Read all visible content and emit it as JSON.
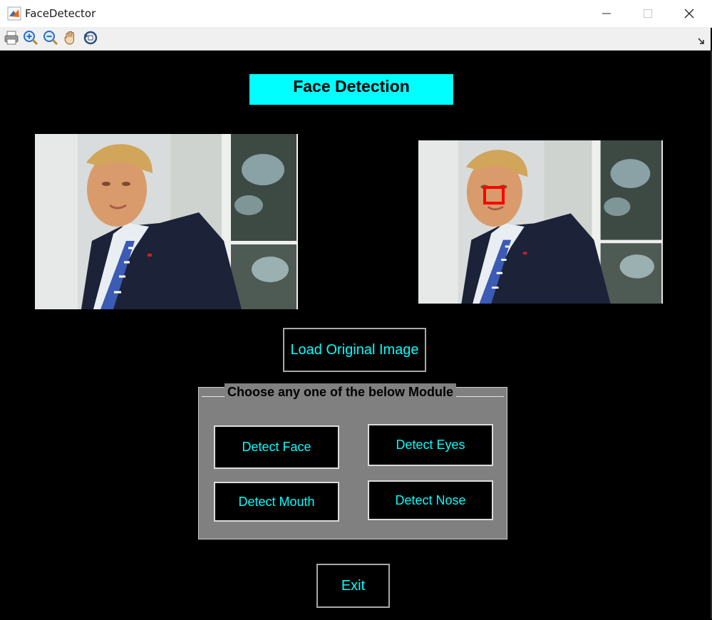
{
  "window": {
    "title": "FaceDetector"
  },
  "toolbar": {
    "tools": [
      {
        "icon": "print-icon"
      },
      {
        "icon": "zoom-in-icon"
      },
      {
        "icon": "zoom-out-icon"
      },
      {
        "icon": "pan-hand-icon"
      },
      {
        "icon": "rotate-3d-icon"
      }
    ]
  },
  "header": {
    "title": "Face Detection"
  },
  "buttons": {
    "load": "Load Original Image",
    "exit": "Exit"
  },
  "modules": {
    "legend": "Choose any one of the below Module",
    "detect_face": "Detect Face",
    "detect_eyes": "Detect Eyes",
    "detect_mouth": "Detect Mouth",
    "detect_nose": "Detect Nose"
  },
  "colors": {
    "title_bg": "#00ffff",
    "button_text": "#00ffff",
    "panel_bg": "#808080",
    "detection_box": "#ff0000"
  }
}
